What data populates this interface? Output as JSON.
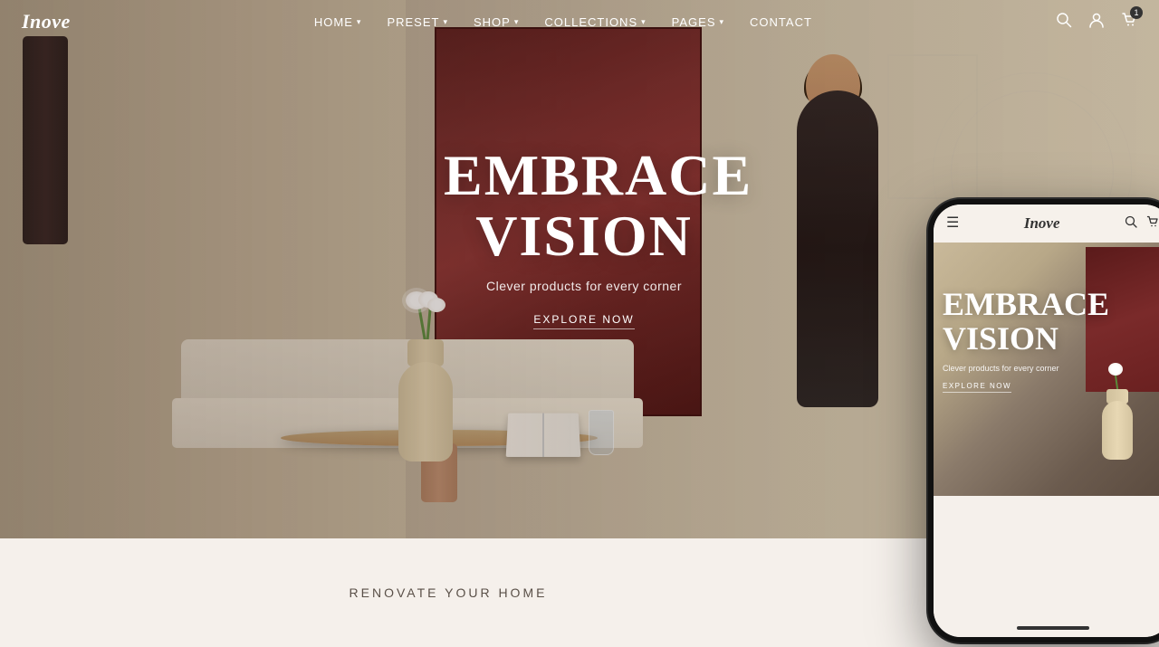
{
  "brand": {
    "name": "Inove"
  },
  "navbar": {
    "links": [
      {
        "label": "HOME",
        "hasDropdown": true
      },
      {
        "label": "PRESET",
        "hasDropdown": true
      },
      {
        "label": "SHOP",
        "hasDropdown": true
      },
      {
        "label": "COLLECTIONS",
        "hasDropdown": true
      },
      {
        "label": "PAGES",
        "hasDropdown": true
      },
      {
        "label": "CONTACT",
        "hasDropdown": false
      }
    ],
    "cart_count": "1"
  },
  "hero": {
    "title_line1": "EMBRACE",
    "title_line2": "VISION",
    "subtitle": "Clever products for every corner",
    "cta_label": "EXPLORE NOW"
  },
  "bottom": {
    "text": "RENOVATE YOUR HOME"
  },
  "phone": {
    "logo": "Inove",
    "hero_title_line1": "EMBRACE",
    "hero_title_line2": "VISION",
    "hero_subtitle": "Clever products for every corner",
    "hero_cta": "EXPLORE NOW"
  }
}
